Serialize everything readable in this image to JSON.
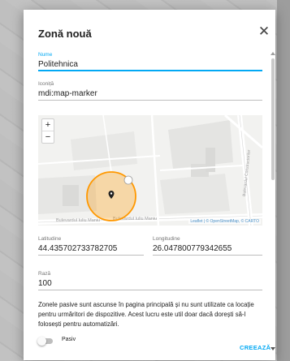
{
  "dialog": {
    "title": "Zonă nouă",
    "close_icon": "close-icon",
    "create_label": "CREEAZĂ"
  },
  "fields": {
    "name": {
      "label": "Nume",
      "value": "Politehnica"
    },
    "icon": {
      "label": "Iconiță",
      "value": "mdi:map-marker"
    },
    "latitude": {
      "label": "Latitudine",
      "value": "44.435702733782705"
    },
    "longitude": {
      "label": "Longitudine",
      "value": "26.047800779342655"
    },
    "radius": {
      "label": "Rază",
      "value": "100"
    }
  },
  "map": {
    "zoom_in": "+",
    "zoom_out": "−",
    "attribution": "Leaflet | © OpenStreetMap, © CARTO",
    "street_1": "Bulevardul Iuliu Maniu",
    "street_2": "Bulevardul Iuliu Maniu",
    "street_3": "Bulevardul Constructorilor",
    "zone_color": "#ff9800",
    "marker_icon": "map-marker-icon"
  },
  "passive": {
    "description": "Zonele pasive sunt ascunse în pagina principală și nu sunt utilizate ca locație pentru urmăritori de dispozitive. Acest lucru este util doar dacă dorești să-l folosești pentru automatizări.",
    "toggle_label": "Pasiv",
    "enabled": false
  },
  "colors": {
    "accent": "#03a9f4",
    "zone": "#ff9800"
  }
}
